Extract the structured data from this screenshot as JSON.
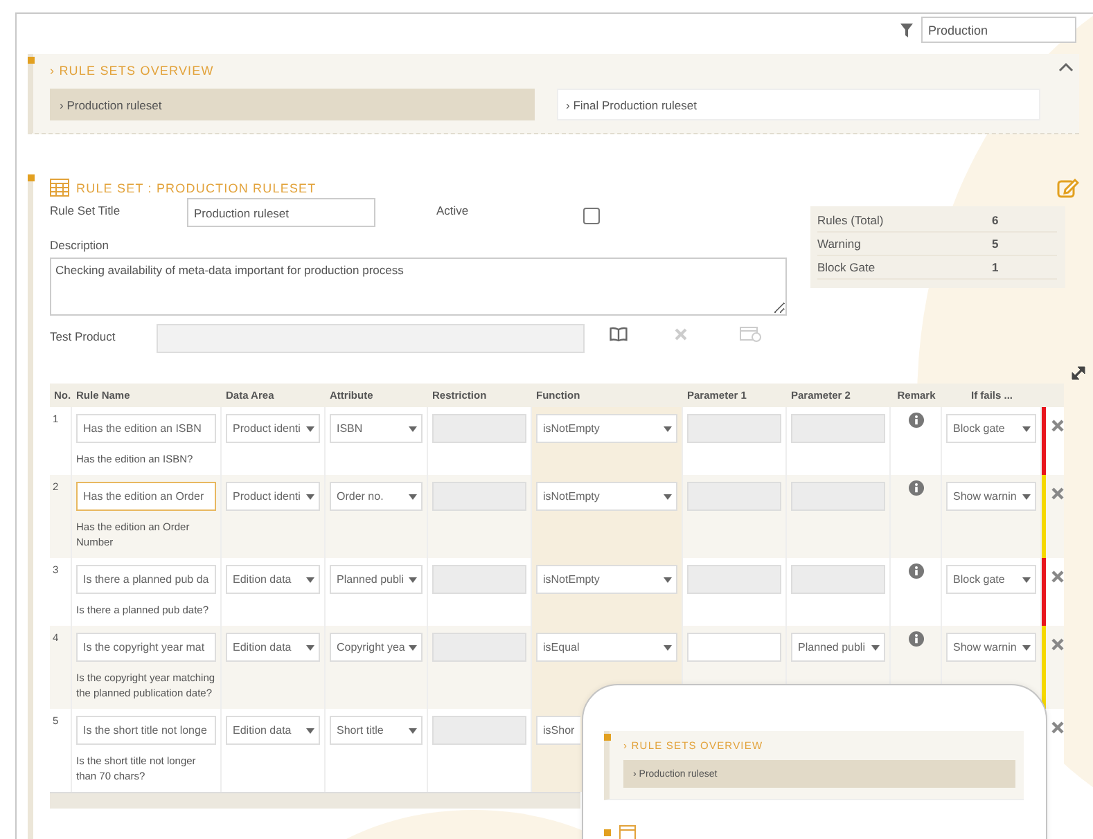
{
  "filter": {
    "value": "Production"
  },
  "overview": {
    "title": "› RULE SETS OVERVIEW",
    "expanded": true,
    "items": [
      {
        "label": "› Production ruleset",
        "selected": true
      },
      {
        "label": "› Final Production ruleset",
        "selected": false
      }
    ]
  },
  "rule_set": {
    "heading": "RULE SET : PRODUCTION RULESET",
    "title_label": "Rule Set Title",
    "title_value": "Production ruleset",
    "active_label": "Active",
    "active_checked": false,
    "description_label": "Description",
    "description_value": "Checking availability of meta-data important for production process",
    "test_product_label": "Test Product",
    "test_product_disabled": true,
    "test_actions": [
      {
        "kind": "book",
        "disabled": false
      },
      {
        "kind": "clear",
        "disabled": true
      },
      {
        "kind": "card",
        "disabled": true
      }
    ],
    "stats": [
      {
        "label": "Rules (Total)",
        "value": "6"
      },
      {
        "label": "Warning",
        "value": "5"
      },
      {
        "label": "Block Gate",
        "value": "1"
      }
    ]
  },
  "table": {
    "columns": [
      "No.",
      "Rule Name",
      "Data Area",
      "Attribute",
      "Restriction",
      "Function",
      "Parameter 1",
      "Parameter 2",
      "Remark",
      "If fails ..."
    ],
    "rules": [
      {
        "no": "1",
        "name": "Has the edition an ISBN",
        "focused": false,
        "description": "Has the edition an ISBN?",
        "data_area": "Product identi",
        "attribute": "ISBN",
        "function": "isNotEmpty",
        "parameter_1": {
          "kind": "disabled"
        },
        "parameter_2": {
          "kind": "disabled"
        },
        "if_fails": "Block gate",
        "color": "#e8141c"
      },
      {
        "no": "2",
        "name": "Has the edition an Order",
        "focused": true,
        "description": "Has the edition an Order Number",
        "data_area": "Product identi",
        "attribute": "Order no.",
        "function": "isNotEmpty",
        "parameter_1": {
          "kind": "disabled"
        },
        "parameter_2": {
          "kind": "disabled"
        },
        "if_fails": "Show warnin",
        "color": "#f5d800"
      },
      {
        "no": "3",
        "name": "Is there a planned pub da",
        "focused": false,
        "description": "Is there a planned pub date?",
        "data_area": "Edition data",
        "attribute": "Planned publi",
        "function": "isNotEmpty",
        "parameter_1": {
          "kind": "disabled"
        },
        "parameter_2": {
          "kind": "disabled"
        },
        "if_fails": "Block gate",
        "color": "#e8141c"
      },
      {
        "no": "4",
        "name": "Is the copyright year mat",
        "focused": false,
        "description": "Is the copyright year matching the planned publication date?",
        "data_area": "Edition data",
        "attribute": "Copyright yea",
        "function": "isEqual",
        "parameter_1": {
          "kind": "input"
        },
        "parameter_2": {
          "kind": "select",
          "value": "Planned publi"
        },
        "if_fails": "Show warnin",
        "color": "#f5d800"
      },
      {
        "no": "5",
        "name": "Is the short title not longe",
        "focused": false,
        "description": "Is the short title not longer than 70 chars?",
        "data_area": "Edition data",
        "attribute": "Short title",
        "function": "isShor"
      }
    ]
  },
  "preview": {
    "title": "› RULE SETS OVERVIEW",
    "items": [
      {
        "label": "› Production ruleset",
        "selected": true
      }
    ]
  }
}
